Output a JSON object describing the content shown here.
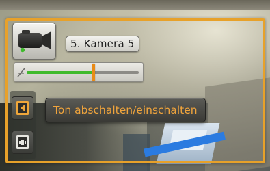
{
  "camera": {
    "name_label": "5. Kamera 5",
    "icon": "video-camera-icon",
    "status_color": "#3fba2c"
  },
  "volume": {
    "level_percent": 60,
    "mute_icon": "speaker-muted-icon"
  },
  "toolbar": {
    "items": [
      {
        "icon": "audio-toggle-icon",
        "active": true
      },
      {
        "icon": "fit-window-icon",
        "active": false
      }
    ]
  },
  "tooltip": {
    "text": "Ton abschalten/einschalten"
  },
  "colors": {
    "accent": "#e7a12a",
    "slider_fill": "#3fba2c",
    "slider_thumb": "#e98b16",
    "tooltip_text": "#f0a43c"
  }
}
